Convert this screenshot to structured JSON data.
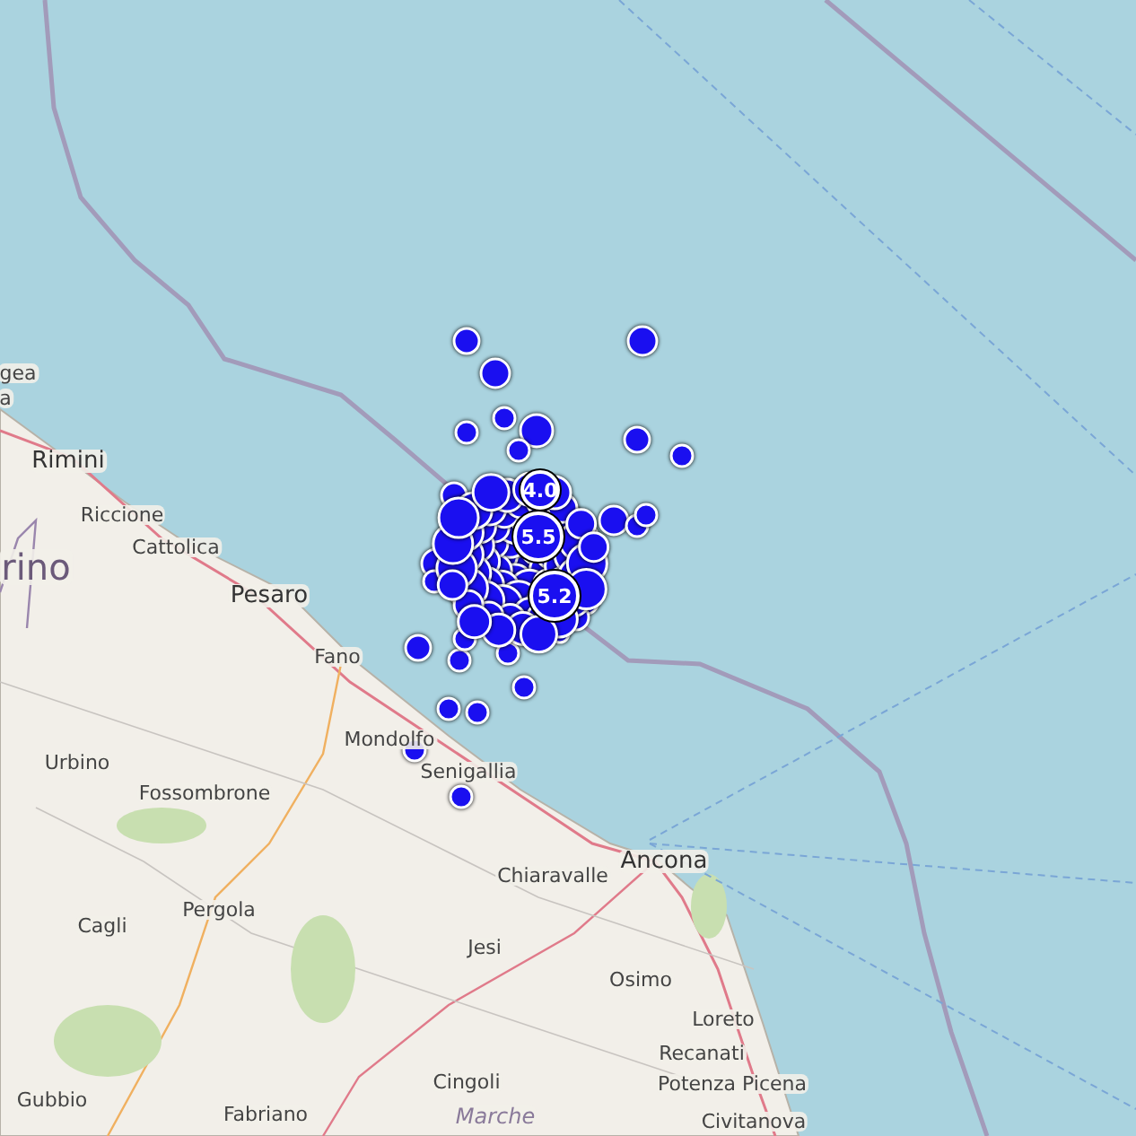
{
  "map": {
    "places": [
      {
        "name": "gea",
        "kind": "town"
      },
      {
        "name": "a",
        "kind": "town"
      },
      {
        "name": "Rimini",
        "kind": "city"
      },
      {
        "name": "Riccione",
        "kind": "town"
      },
      {
        "name": "Cattolica",
        "kind": "town"
      },
      {
        "name": "rino",
        "kind": "region"
      },
      {
        "name": "Pesaro",
        "kind": "city"
      },
      {
        "name": "Fano",
        "kind": "town"
      },
      {
        "name": "Mondolfo",
        "kind": "town"
      },
      {
        "name": "Senigallia",
        "kind": "town"
      },
      {
        "name": "Urbino",
        "kind": "town"
      },
      {
        "name": "Fossombrone",
        "kind": "town"
      },
      {
        "name": "Chiaravalle",
        "kind": "town"
      },
      {
        "name": "Ancona",
        "kind": "city"
      },
      {
        "name": "Pergola",
        "kind": "town"
      },
      {
        "name": "Cagli",
        "kind": "town"
      },
      {
        "name": "Jesi",
        "kind": "town"
      },
      {
        "name": "Osimo",
        "kind": "town"
      },
      {
        "name": "Loreto",
        "kind": "town"
      },
      {
        "name": "Recanati",
        "kind": "town"
      },
      {
        "name": "Cingoli",
        "kind": "town"
      },
      {
        "name": "Potenza Picena",
        "kind": "town"
      },
      {
        "name": "Gubbio",
        "kind": "town"
      },
      {
        "name": "Fabriano",
        "kind": "town"
      },
      {
        "name": "Marche",
        "kind": "area"
      },
      {
        "name": "Civitanova",
        "kind": "town"
      }
    ],
    "magnitudes": [
      {
        "label": "4.0"
      },
      {
        "label": "5.5"
      },
      {
        "label": "5.2"
      }
    ]
  }
}
